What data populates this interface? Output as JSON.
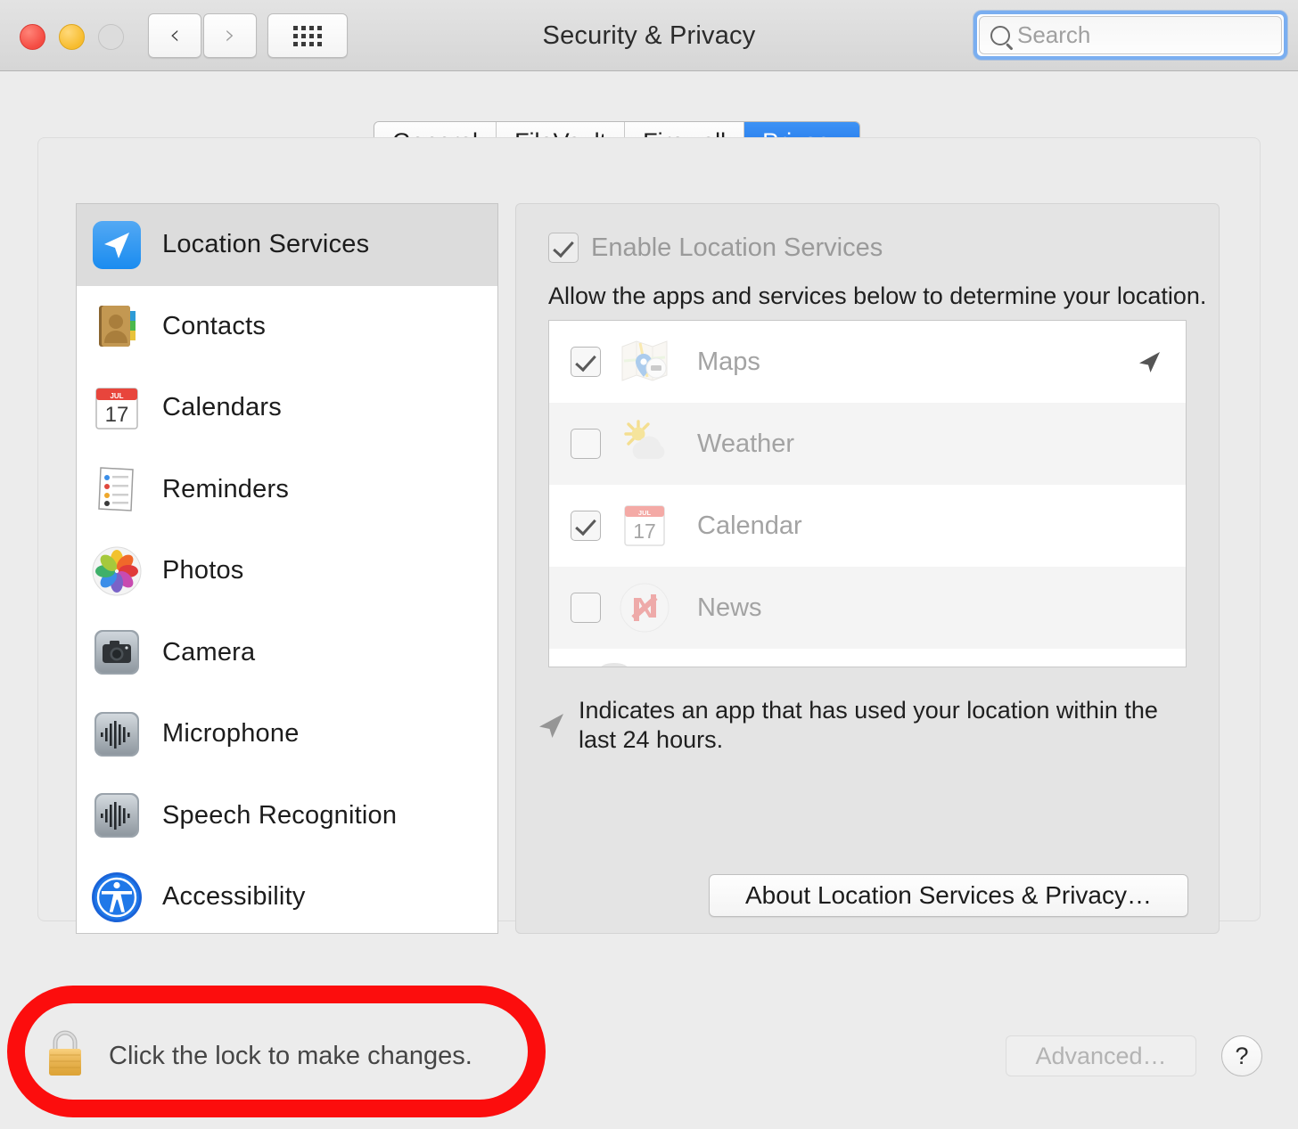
{
  "window": {
    "title": "Security & Privacy",
    "traffic_lights": [
      "close",
      "minimize",
      "zoom"
    ],
    "nav": {
      "back": "‹",
      "forward": "›",
      "grid": "grid-view"
    }
  },
  "search": {
    "placeholder": "Search",
    "value": "",
    "icon": "search-icon"
  },
  "tabs": [
    {
      "label": "General",
      "active": false
    },
    {
      "label": "FileVault",
      "active": false
    },
    {
      "label": "Firewall",
      "active": false
    },
    {
      "label": "Privacy",
      "active": true
    }
  ],
  "sidebar": {
    "items": [
      {
        "label": "Location Services",
        "icon": "location-arrow-icon",
        "selected": true
      },
      {
        "label": "Contacts",
        "icon": "contacts-book-icon",
        "selected": false
      },
      {
        "label": "Calendars",
        "icon": "calendar-icon",
        "selected": false
      },
      {
        "label": "Reminders",
        "icon": "reminders-list-icon",
        "selected": false
      },
      {
        "label": "Photos",
        "icon": "photos-pinwheel-icon",
        "selected": false
      },
      {
        "label": "Camera",
        "icon": "camera-icon",
        "selected": false
      },
      {
        "label": "Microphone",
        "icon": "waveform-icon",
        "selected": false
      },
      {
        "label": "Speech Recognition",
        "icon": "waveform-icon",
        "selected": false
      },
      {
        "label": "Accessibility",
        "icon": "accessibility-person-icon",
        "selected": false
      }
    ]
  },
  "panel": {
    "enable_checkbox": {
      "label": "Enable Location Services",
      "checked": true,
      "disabled": true
    },
    "description": "Allow the apps and services below to determine your location.",
    "apps": [
      {
        "name": "Maps",
        "icon": "maps-icon",
        "checked": true,
        "recently_used": true
      },
      {
        "name": "Weather",
        "icon": "weather-icon",
        "checked": false,
        "recently_used": false
      },
      {
        "name": "Calendar",
        "icon": "calendar-icon",
        "checked": true,
        "recently_used": false
      },
      {
        "name": "News",
        "icon": "news-icon",
        "checked": false,
        "recently_used": false
      }
    ],
    "footnote": "Indicates an app that has used your location within the last 24 hours.",
    "footnote_icon": "location-arrow-icon",
    "about_button": "About Location Services & Privacy…"
  },
  "bottom": {
    "lock_icon": "padlock-closed-icon",
    "lock_text": "Click the lock to make changes.",
    "advanced_button": {
      "label": "Advanced…",
      "disabled": true
    },
    "help_button": "?"
  },
  "annotation": {
    "shape": "rounded-rectangle-highlight",
    "color": "#FC0D0D",
    "target": "lock-row"
  },
  "calendar_icon": {
    "month": "JUL",
    "day": "17"
  }
}
